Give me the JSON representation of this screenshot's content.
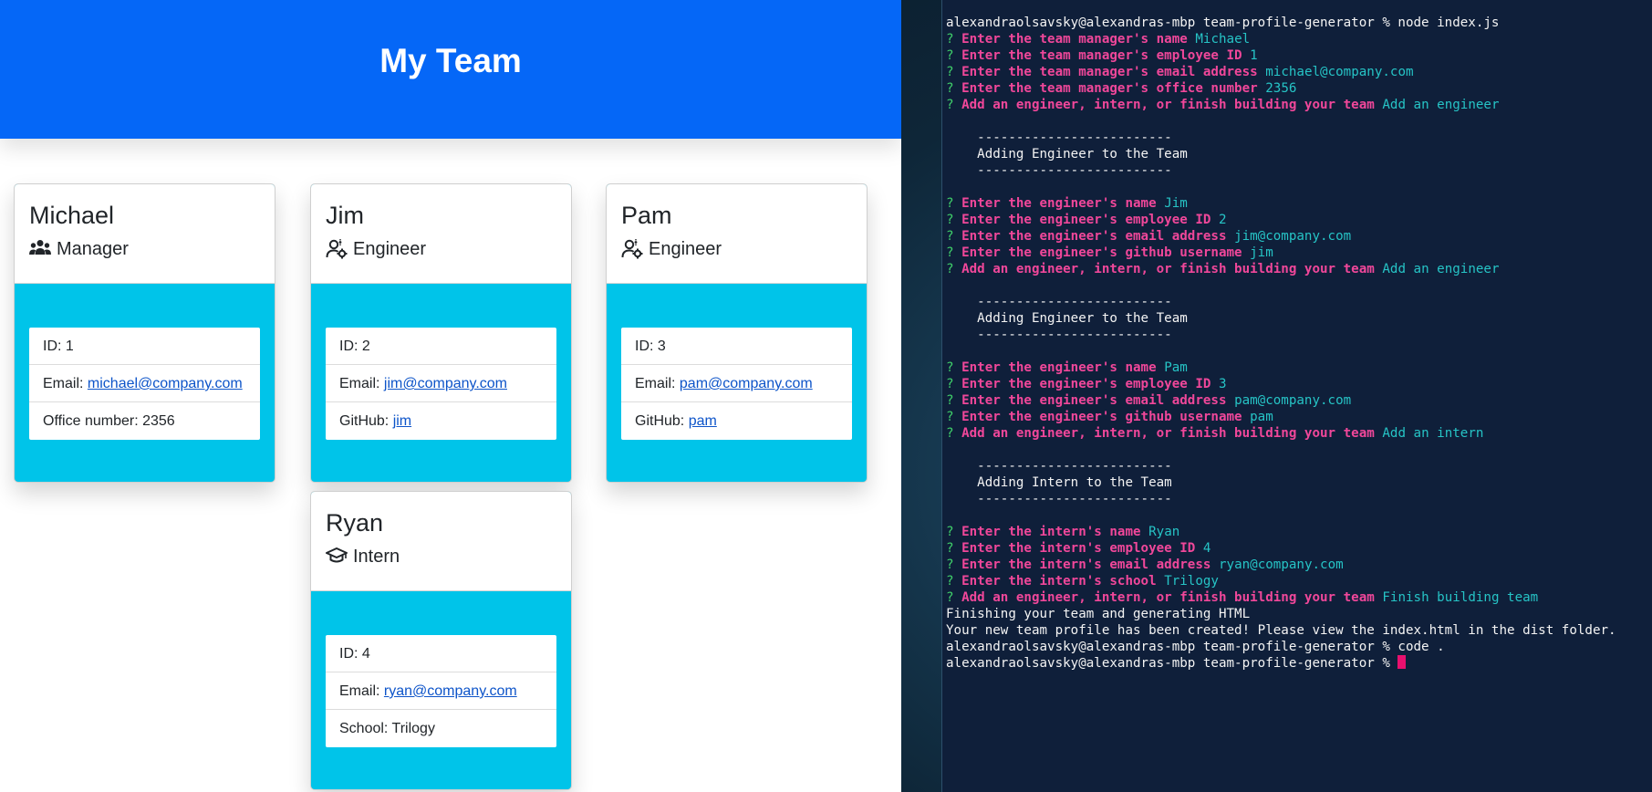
{
  "page": {
    "title": "My Team"
  },
  "cards": [
    {
      "name": "Michael",
      "role": "Manager",
      "role_icon": "users-icon",
      "id_text": "ID: 1",
      "email_label": "Email: ",
      "email": "michael@company.com",
      "extra_label": "Office number: 2356",
      "extra_link": ""
    },
    {
      "name": "Jim",
      "role": "Engineer",
      "role_icon": "user-cog-icon",
      "id_text": "ID: 2",
      "email_label": "Email: ",
      "email": "jim@company.com",
      "extra_label": "GitHub: ",
      "extra_link": "jim"
    },
    {
      "name": "Pam",
      "role": "Engineer",
      "role_icon": "user-cog-icon",
      "id_text": "ID: 3",
      "email_label": "Email: ",
      "email": "pam@company.com",
      "extra_label": "GitHub: ",
      "extra_link": "pam"
    },
    {
      "name": "Ryan",
      "role": "Intern",
      "role_icon": "graduation-cap-icon",
      "id_text": "ID: 4",
      "email_label": "Email: ",
      "email": "ryan@company.com",
      "extra_label": "School: Trilogy",
      "extra_link": ""
    }
  ],
  "terminal": {
    "prompt": "alexandraolsavsky@alexandras-mbp team-profile-generator % ",
    "lines": [
      {
        "t": "cmd",
        "text": "node index.js"
      },
      {
        "t": "qa",
        "q": "Enter the team manager's name",
        "a": "Michael"
      },
      {
        "t": "qa",
        "q": "Enter the team manager's employee ID",
        "a": "1"
      },
      {
        "t": "qa",
        "q": "Enter the team manager's email address",
        "a": "michael@company.com"
      },
      {
        "t": "qa",
        "q": "Enter the team manager's office number",
        "a": "2356"
      },
      {
        "t": "qa",
        "q": "Add an engineer, intern, or finish building your team",
        "a": "Add an engineer"
      },
      {
        "t": "blank"
      },
      {
        "t": "text",
        "text": "    -------------------------"
      },
      {
        "t": "text",
        "text": "    Adding Engineer to the Team"
      },
      {
        "t": "text",
        "text": "    -------------------------"
      },
      {
        "t": "blank"
      },
      {
        "t": "qa",
        "q": "Enter the engineer's name",
        "a": "Jim"
      },
      {
        "t": "qa",
        "q": "Enter the engineer's employee ID",
        "a": "2"
      },
      {
        "t": "qa",
        "q": "Enter the engineer's email address",
        "a": "jim@company.com"
      },
      {
        "t": "qa",
        "q": "Enter the engineer's github username",
        "a": "jim"
      },
      {
        "t": "qa",
        "q": "Add an engineer, intern, or finish building your team",
        "a": "Add an engineer"
      },
      {
        "t": "blank"
      },
      {
        "t": "text",
        "text": "    -------------------------"
      },
      {
        "t": "text",
        "text": "    Adding Engineer to the Team"
      },
      {
        "t": "text",
        "text": "    -------------------------"
      },
      {
        "t": "blank"
      },
      {
        "t": "qa",
        "q": "Enter the engineer's name",
        "a": "Pam"
      },
      {
        "t": "qa",
        "q": "Enter the engineer's employee ID",
        "a": "3"
      },
      {
        "t": "qa",
        "q": "Enter the engineer's email address",
        "a": "pam@company.com"
      },
      {
        "t": "qa",
        "q": "Enter the engineer's github username",
        "a": "pam"
      },
      {
        "t": "qa",
        "q": "Add an engineer, intern, or finish building your team",
        "a": "Add an intern"
      },
      {
        "t": "blank"
      },
      {
        "t": "text",
        "text": "    -------------------------"
      },
      {
        "t": "text",
        "text": "    Adding Intern to the Team"
      },
      {
        "t": "text",
        "text": "    -------------------------"
      },
      {
        "t": "blank"
      },
      {
        "t": "qa",
        "q": "Enter the intern's name",
        "a": "Ryan"
      },
      {
        "t": "qa",
        "q": "Enter the intern's employee ID",
        "a": "4"
      },
      {
        "t": "qa",
        "q": "Enter the intern's email address",
        "a": "ryan@company.com"
      },
      {
        "t": "qa",
        "q": "Enter the intern's school",
        "a": "Trilogy"
      },
      {
        "t": "qa",
        "q": "Add an engineer, intern, or finish building your team",
        "a": "Finish building team"
      },
      {
        "t": "text",
        "text": "Finishing your team and generating HTML"
      },
      {
        "t": "text",
        "text": "Your new team profile has been created! Please view the index.html in the dist folder."
      },
      {
        "t": "cmd",
        "text": "code ."
      },
      {
        "t": "cursor",
        "text": ""
      }
    ]
  },
  "colors": {
    "header_bg": "#0567f7",
    "card_body_bg": "#00c4e9",
    "terminal_bg": "#0f1f3a",
    "prompt_question": "#f0479a",
    "answer": "#26c4c6",
    "question_mark": "#3fcf6a",
    "cursor": "#e8106e"
  }
}
